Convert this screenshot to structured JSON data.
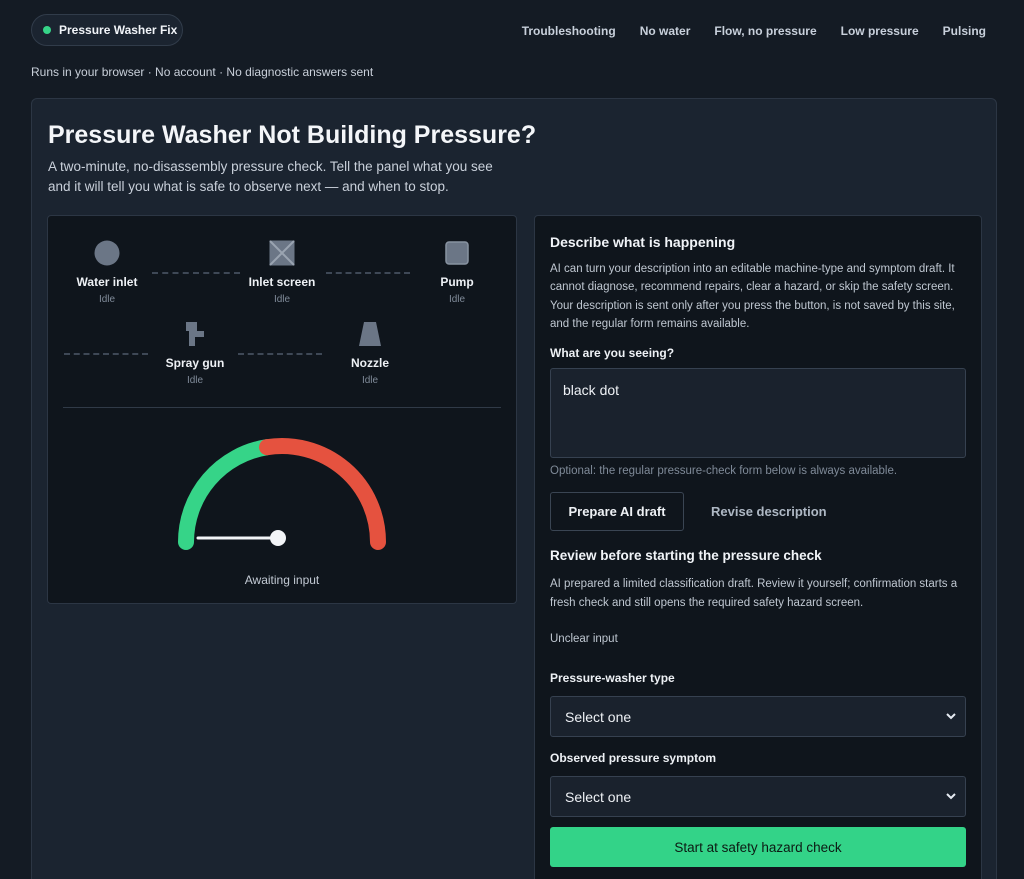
{
  "brand": {
    "name": "Pressure Washer Fix",
    "status_color": "#36d488"
  },
  "nav": [
    "Troubleshooting",
    "No water",
    "Flow, no pressure",
    "Low pressure",
    "Pulsing"
  ],
  "tagline": "Runs in your browser · No account · No diagnostic answers sent",
  "main": {
    "title": "Pressure Washer Not Building Pressure?",
    "intro": "A two-minute, no-disassembly pressure check. Tell the panel what you see and it will tell you what is safe to observe next — and when to stop."
  },
  "diagram": {
    "nodes": [
      {
        "label": "Water inlet",
        "state": "Idle",
        "icon": "water-inlet-icon"
      },
      {
        "label": "Inlet screen",
        "state": "Idle",
        "icon": "inlet-screen-icon"
      },
      {
        "label": "Pump",
        "state": "Idle",
        "icon": "pump-icon"
      },
      {
        "label": "Spray gun",
        "state": "Idle",
        "icon": "spray-gun-icon"
      },
      {
        "label": "Nozzle",
        "state": "Idle",
        "icon": "nozzle-icon"
      }
    ],
    "gauge": {
      "label": "Awaiting input",
      "needle_fraction": 0.0,
      "low_color": "#36d488",
      "high_color": "#e5523f"
    }
  },
  "ai_panel": {
    "title": "Describe what is happening",
    "description": "AI can turn your description into an editable machine-type and symptom draft. It cannot diagnose, recommend repairs, clear a hazard, or skip the safety screen. Your description is sent only after you press the button, is not saved by this site, and the regular form remains available.",
    "input_label": "What are you seeing?",
    "input_value": "black dot",
    "hint": "Optional: the regular pressure-check form below is always available.",
    "prepare_button": "Prepare AI draft",
    "revise_button": "Revise description"
  },
  "review": {
    "title": "Review before starting the pressure check",
    "description": "AI prepared a limited classification draft. Review it yourself; confirmation starts a fresh check and still opens the required safety hazard screen.",
    "status": "Unclear input",
    "type_label": "Pressure-washer type",
    "type_value": "Select one",
    "symptom_label": "Observed pressure symptom",
    "symptom_value": "Select one",
    "start_button": "Start at safety hazard check",
    "accent": "#33d388"
  }
}
